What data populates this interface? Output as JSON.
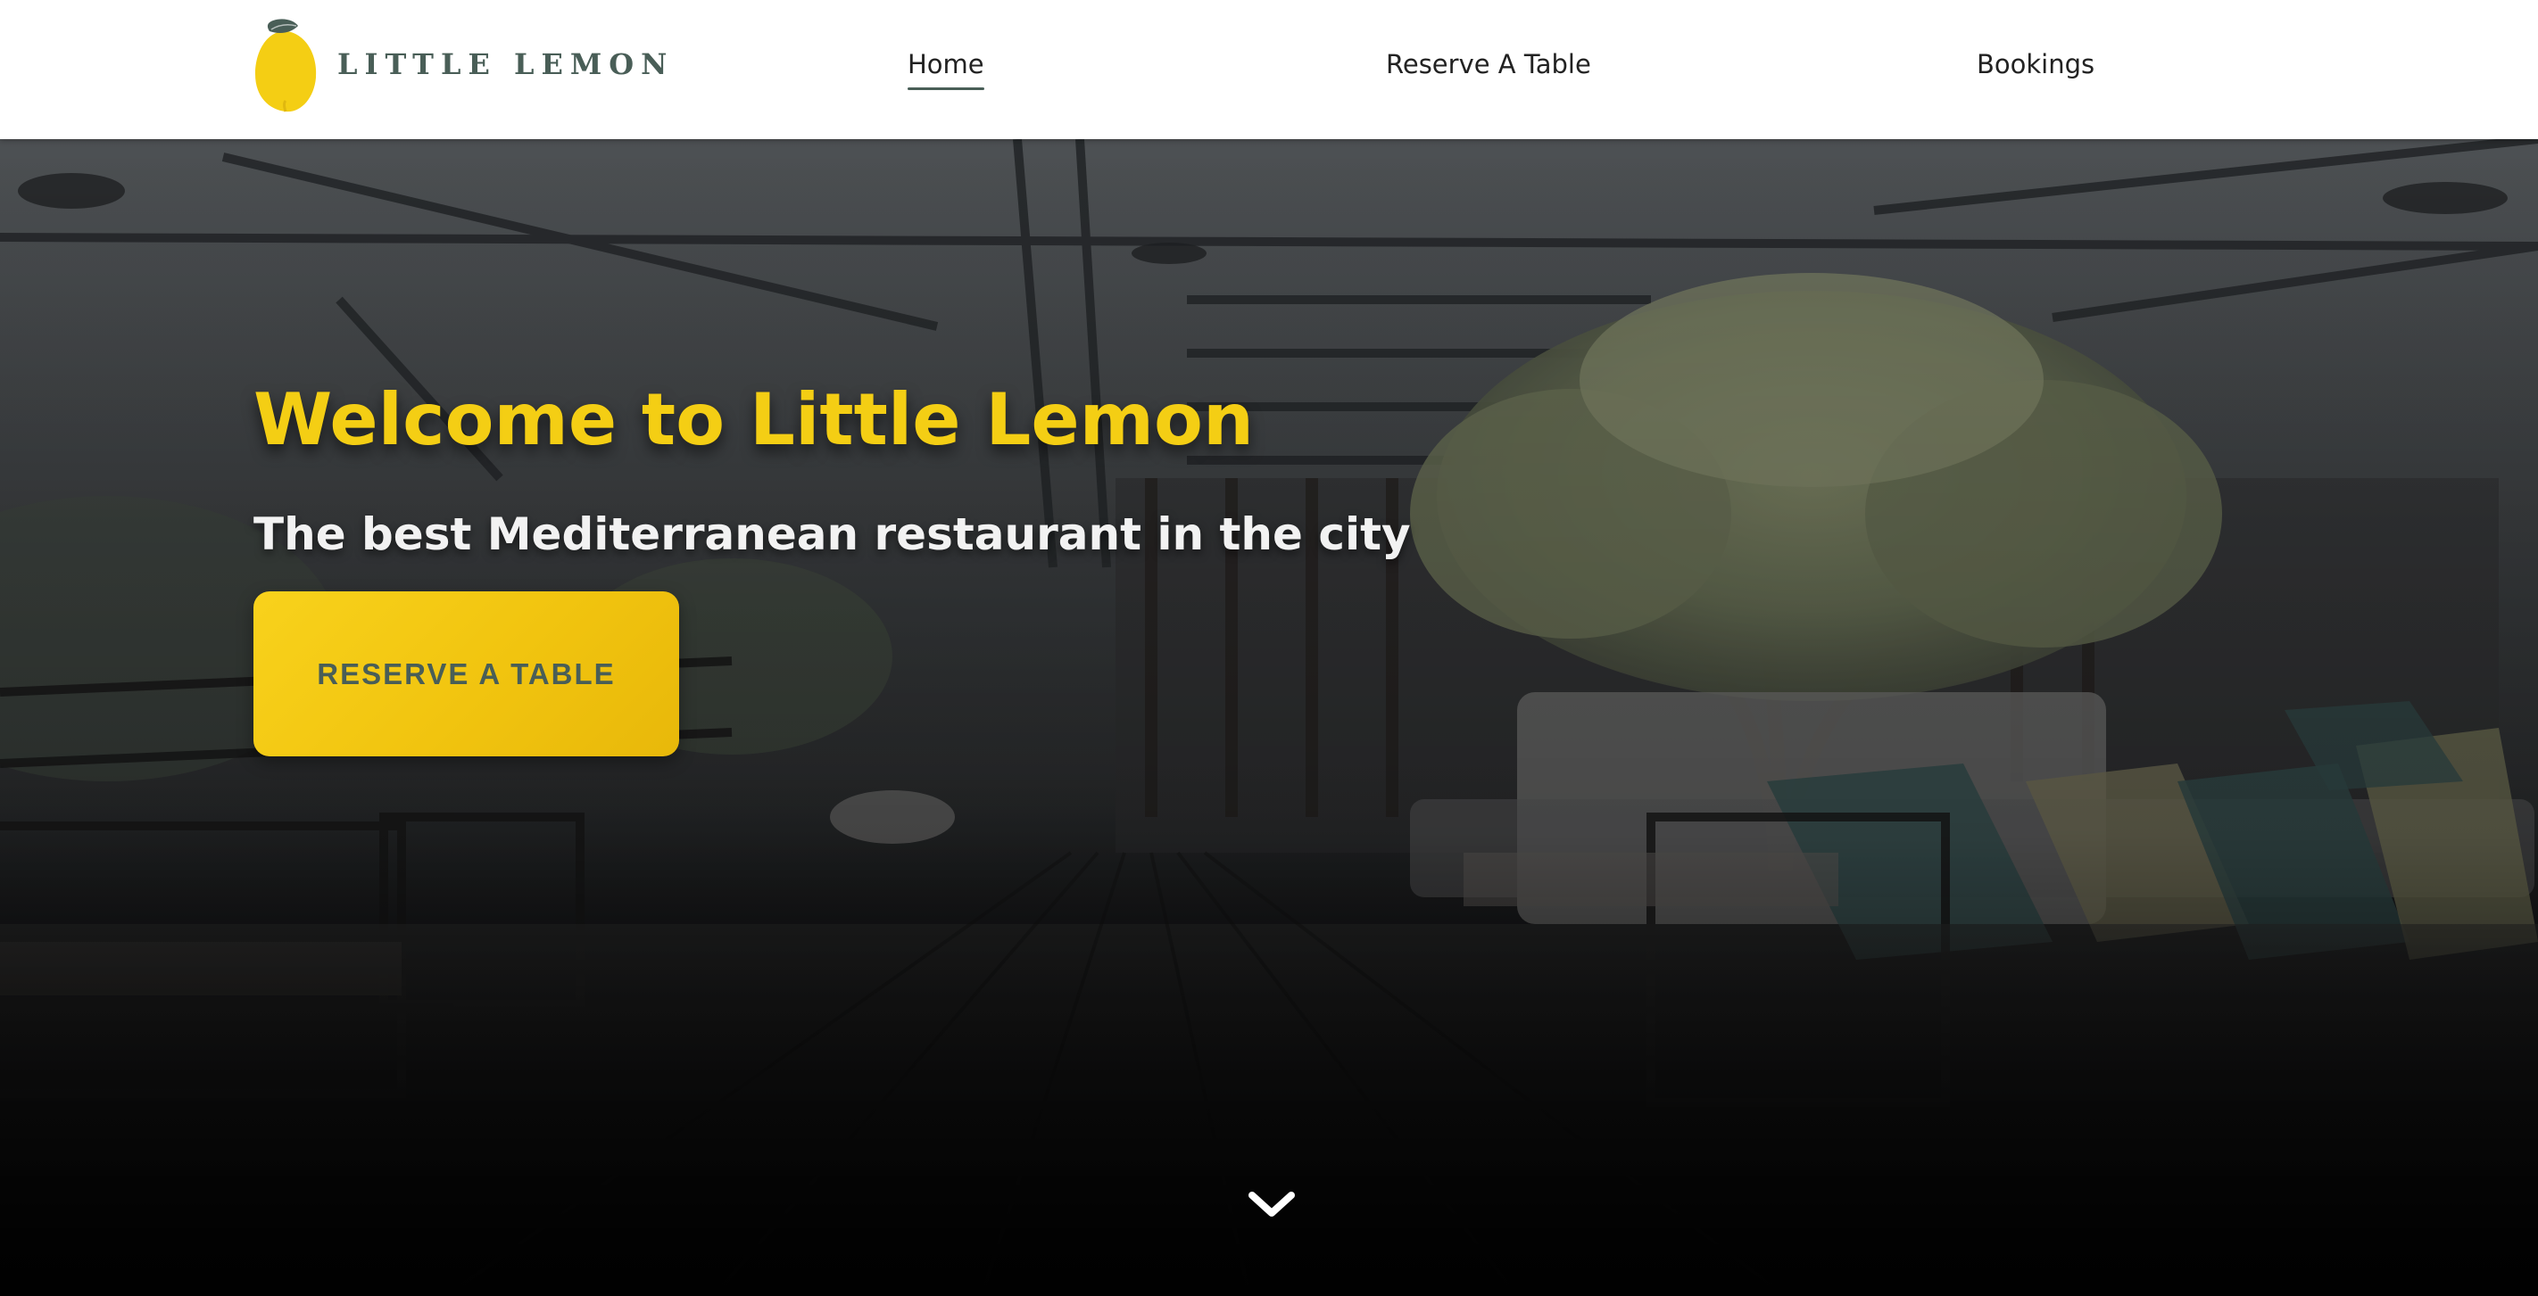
{
  "brand": {
    "name": "LITTLE LEMON",
    "icon": "lemon-icon",
    "colors": {
      "lemon_yellow": "#f4ce14",
      "lemon_green": "#495e57",
      "leaf": "#495e57"
    }
  },
  "nav": {
    "items": [
      {
        "label": "Home",
        "active": true
      },
      {
        "label": "Reserve A Table",
        "active": false
      },
      {
        "label": "Bookings",
        "active": false
      }
    ]
  },
  "hero": {
    "title": "Welcome to Little Lemon",
    "subtitle": "The best Mediterranean restaurant in the city",
    "cta_label": "RESERVE A TABLE",
    "scroll_icon": "chevron-down-icon",
    "colors": {
      "title": "#f4ce14",
      "subtitle": "#f2f2f2",
      "cta_bg": "#f4ce14",
      "cta_text": "#495e57"
    }
  }
}
